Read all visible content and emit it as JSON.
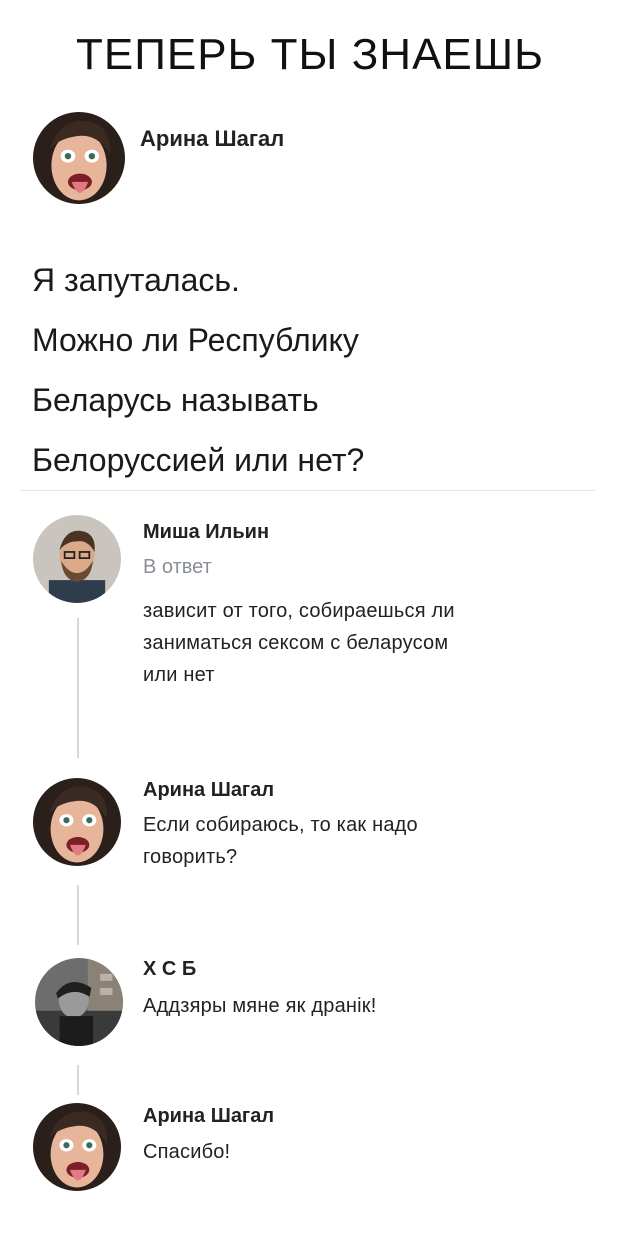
{
  "headline": "ТЕПЕРЬ ТЫ ЗНАЕШЬ",
  "post": {
    "author": "Арина Шагал",
    "lines": [
      "Я запуталась.",
      "Можно ли Республику",
      "Беларусь называть",
      "Белоруссией или нет?"
    ]
  },
  "comments": [
    {
      "author": "Миша Ильин",
      "reply_label": "В ответ",
      "lines": [
        "зависит от того, собираешься ли",
        "заниматься сексом с беларусом",
        "или нет"
      ]
    },
    {
      "author": "Арина Шагал",
      "lines": [
        "Если собираюсь, то как надо",
        "говорить?"
      ]
    },
    {
      "author": "Х С Б",
      "lines": [
        "Аддзяры мяне як дранік!"
      ]
    },
    {
      "author": "Арина Шагал",
      "lines": [
        "Спасибо!"
      ]
    }
  ],
  "colors": {
    "secondary_text": "#8a8f96",
    "thread_line": "#d7d8db",
    "divider": "#e3e4e8"
  }
}
